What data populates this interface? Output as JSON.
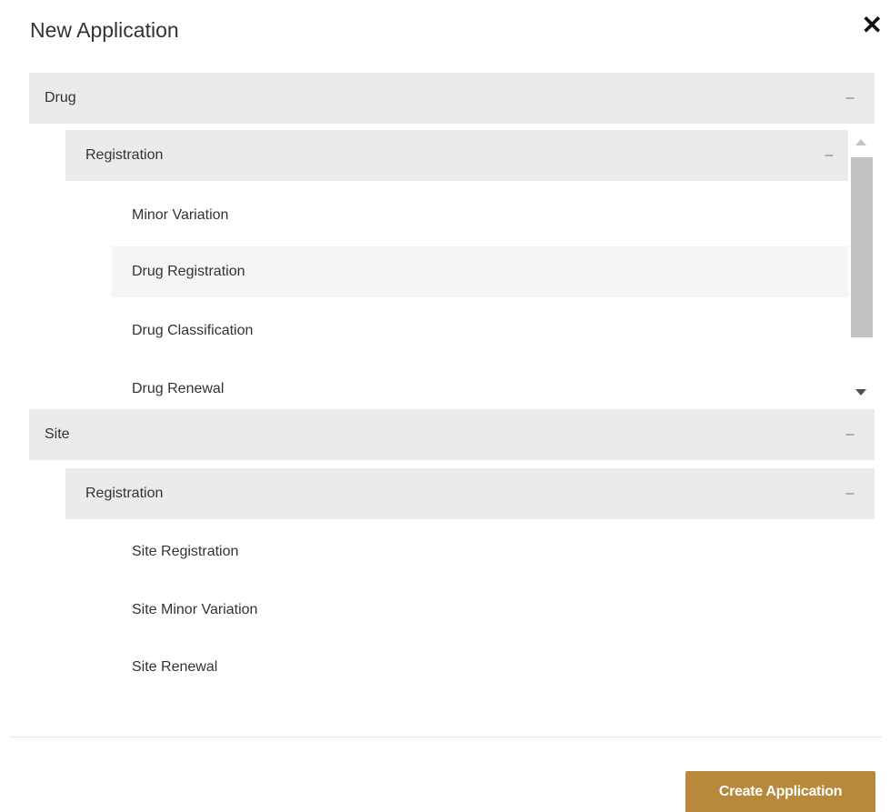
{
  "modal": {
    "title": "New Application",
    "close_icon": "close-icon"
  },
  "tree": {
    "drug": {
      "label": "Drug",
      "toggle": "–",
      "registration": {
        "label": "Registration",
        "toggle": "–",
        "items": [
          "Minor Variation",
          "Drug Registration",
          "Drug Classification",
          "Drug Renewal"
        ]
      }
    },
    "site": {
      "label": "Site",
      "toggle": "–",
      "registration": {
        "label": "Registration",
        "toggle": "–",
        "items": [
          "Site Registration",
          "Site Minor Variation",
          "Site Renewal"
        ]
      }
    }
  },
  "footer": {
    "create_label": "Create Application",
    "create_color": "#b8893a"
  }
}
